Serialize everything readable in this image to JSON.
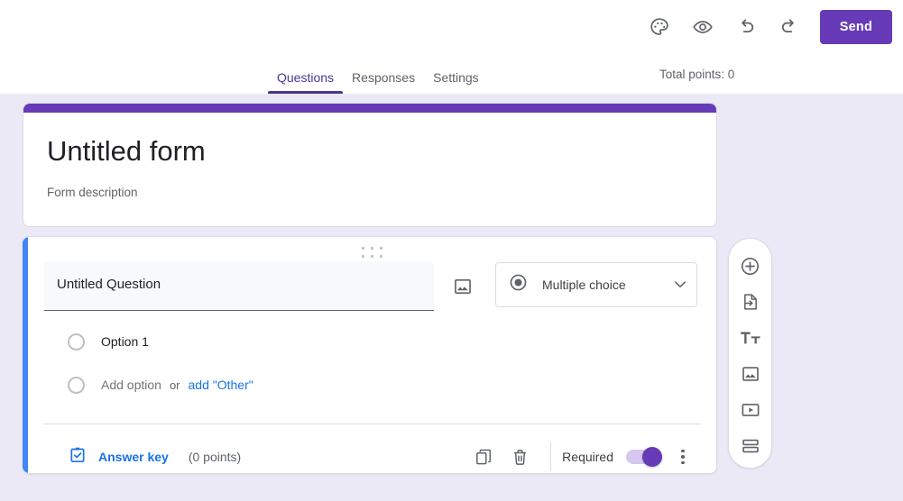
{
  "topbar": {
    "actions": [
      {
        "name": "theme-palette-icon",
        "tooltip": "Customize theme"
      },
      {
        "name": "preview-eye-icon",
        "tooltip": "Preview"
      },
      {
        "name": "undo-icon",
        "tooltip": "Undo"
      },
      {
        "name": "redo-icon",
        "tooltip": "Redo"
      }
    ],
    "send_label": "Send"
  },
  "tabbar": {
    "tabs": [
      {
        "label": "Questions",
        "active": true
      },
      {
        "label": "Responses",
        "active": false
      },
      {
        "label": "Settings",
        "active": false
      }
    ],
    "total_points": "Total points: 0"
  },
  "form": {
    "title": "Untitled form",
    "description": "Form description",
    "header_color": "#673ab7"
  },
  "question": {
    "accent_color": "#4285f4",
    "title_value": "Untitled Question",
    "type_label": "Multiple choice",
    "options": [
      {
        "label": "Option 1",
        "muted": false
      }
    ],
    "add_option_label": "Add option",
    "or_label": "or",
    "add_other_label": "add \"Other\"",
    "answer_key_label": "Answer key",
    "points_label": "(0 points)",
    "required_label": "Required",
    "required_on": true,
    "duplicate_tooltip": "Duplicate",
    "delete_tooltip": "Delete",
    "more_tooltip": "More options"
  },
  "toolbar": {
    "items": [
      {
        "name": "add-question-icon",
        "tooltip": "Add question"
      },
      {
        "name": "import-questions-icon",
        "tooltip": "Import questions"
      },
      {
        "name": "add-title-description-icon",
        "tooltip": "Add title and description"
      },
      {
        "name": "add-image-icon",
        "tooltip": "Add image"
      },
      {
        "name": "add-video-icon",
        "tooltip": "Add video"
      },
      {
        "name": "add-section-icon",
        "tooltip": "Add section"
      }
    ]
  },
  "colors": {
    "brand_purple": "#673ab7",
    "tab_active": "#4a3691",
    "accent_blue": "#4285f4",
    "link_blue": "#1a73e8",
    "canvas_bg": "#ece9f6"
  }
}
